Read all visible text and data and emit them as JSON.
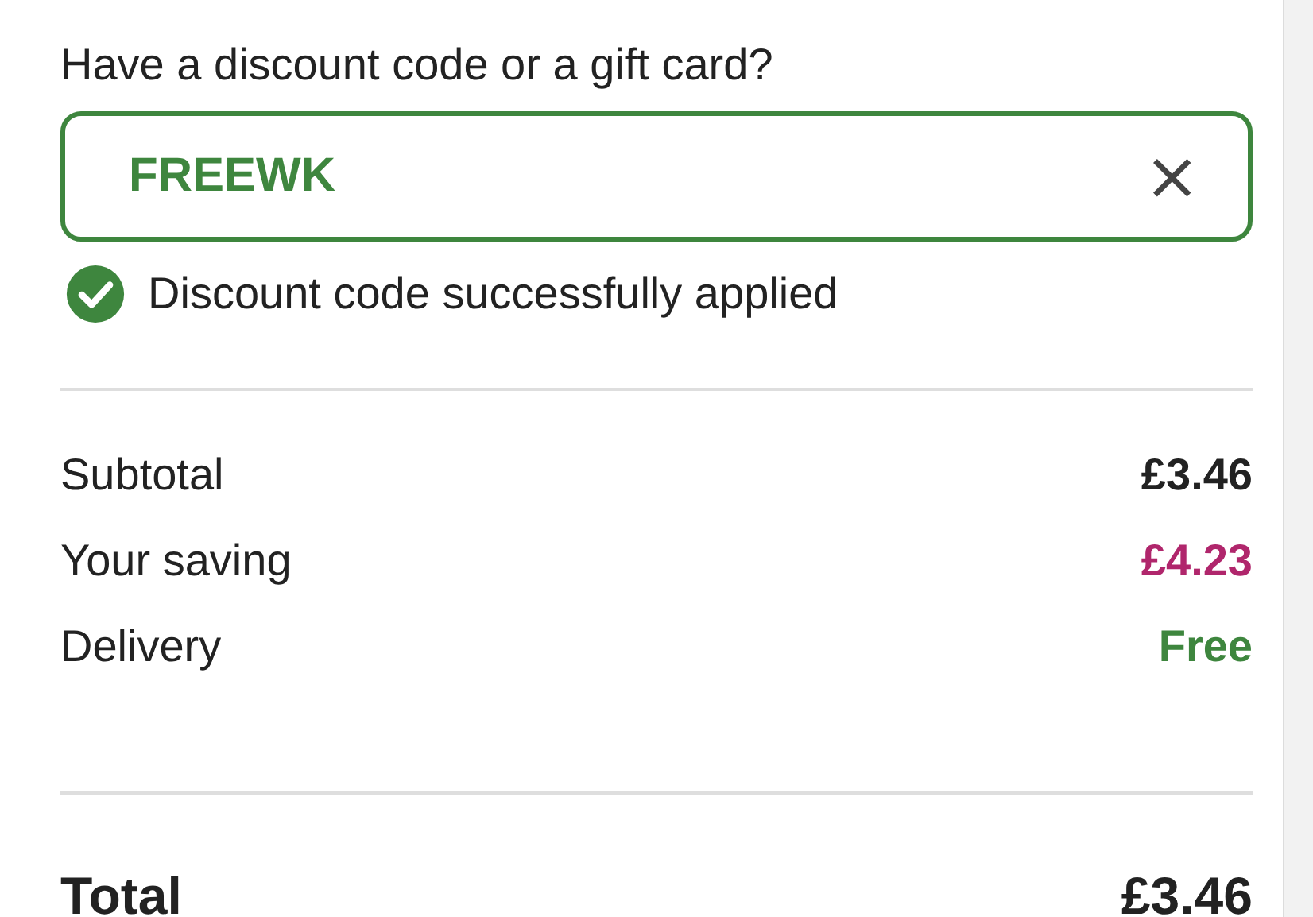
{
  "discount": {
    "label": "Have a discount code or a gift card?",
    "value": "FREEWK",
    "clear_button": "×",
    "message": "Discount code successfully applied"
  },
  "summary": [
    {
      "label": "Subtotal",
      "value": "£3.46",
      "kind": "amount"
    },
    {
      "label": "Your saving",
      "value": "£4.23",
      "kind": "saving"
    },
    {
      "label": "Delivery",
      "value": "Free",
      "kind": "free"
    }
  ],
  "total": {
    "label": "Total",
    "value": "£3.46"
  }
}
